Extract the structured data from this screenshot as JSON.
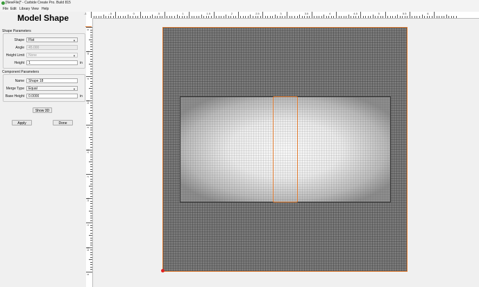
{
  "window": {
    "title": "[NewFile]* - Carbide Create Pro. Build 815"
  },
  "menu": [
    "File",
    "Edit",
    "Library",
    "View",
    "Help"
  ],
  "panel": {
    "title": "Model Shape",
    "shape_params_label": "Shape Parameters",
    "shape": {
      "label": "Shape",
      "value": "Flat"
    },
    "angle": {
      "label": "Angle",
      "value": "45.000"
    },
    "height_limit": {
      "label": "Height Limit",
      "value": "None"
    },
    "height": {
      "label": "Height",
      "value": "1",
      "unit": "in"
    },
    "component_params_label": "Component Parameters",
    "name": {
      "label": "Name",
      "value": "Shape 18"
    },
    "merge_type": {
      "label": "Merge Type",
      "value": "Equal"
    },
    "base_height": {
      "label": "Base Height",
      "value": "0.0000",
      "unit": "in"
    },
    "show3d": "Show 3D",
    "apply": "Apply",
    "done": "Done"
  },
  "ruler": {
    "h_labels": [
      "-1",
      "-.5",
      "0",
      ".5",
      "1",
      "1.5",
      "2",
      "2.5",
      "3",
      "3.5",
      "4",
      "4.5",
      "5",
      "5.5",
      "6"
    ],
    "v_labels": [
      "5",
      "4.5",
      "4",
      "3.5",
      "3",
      "2.5",
      "2",
      "1.5",
      "1",
      "0.5",
      "0"
    ]
  }
}
